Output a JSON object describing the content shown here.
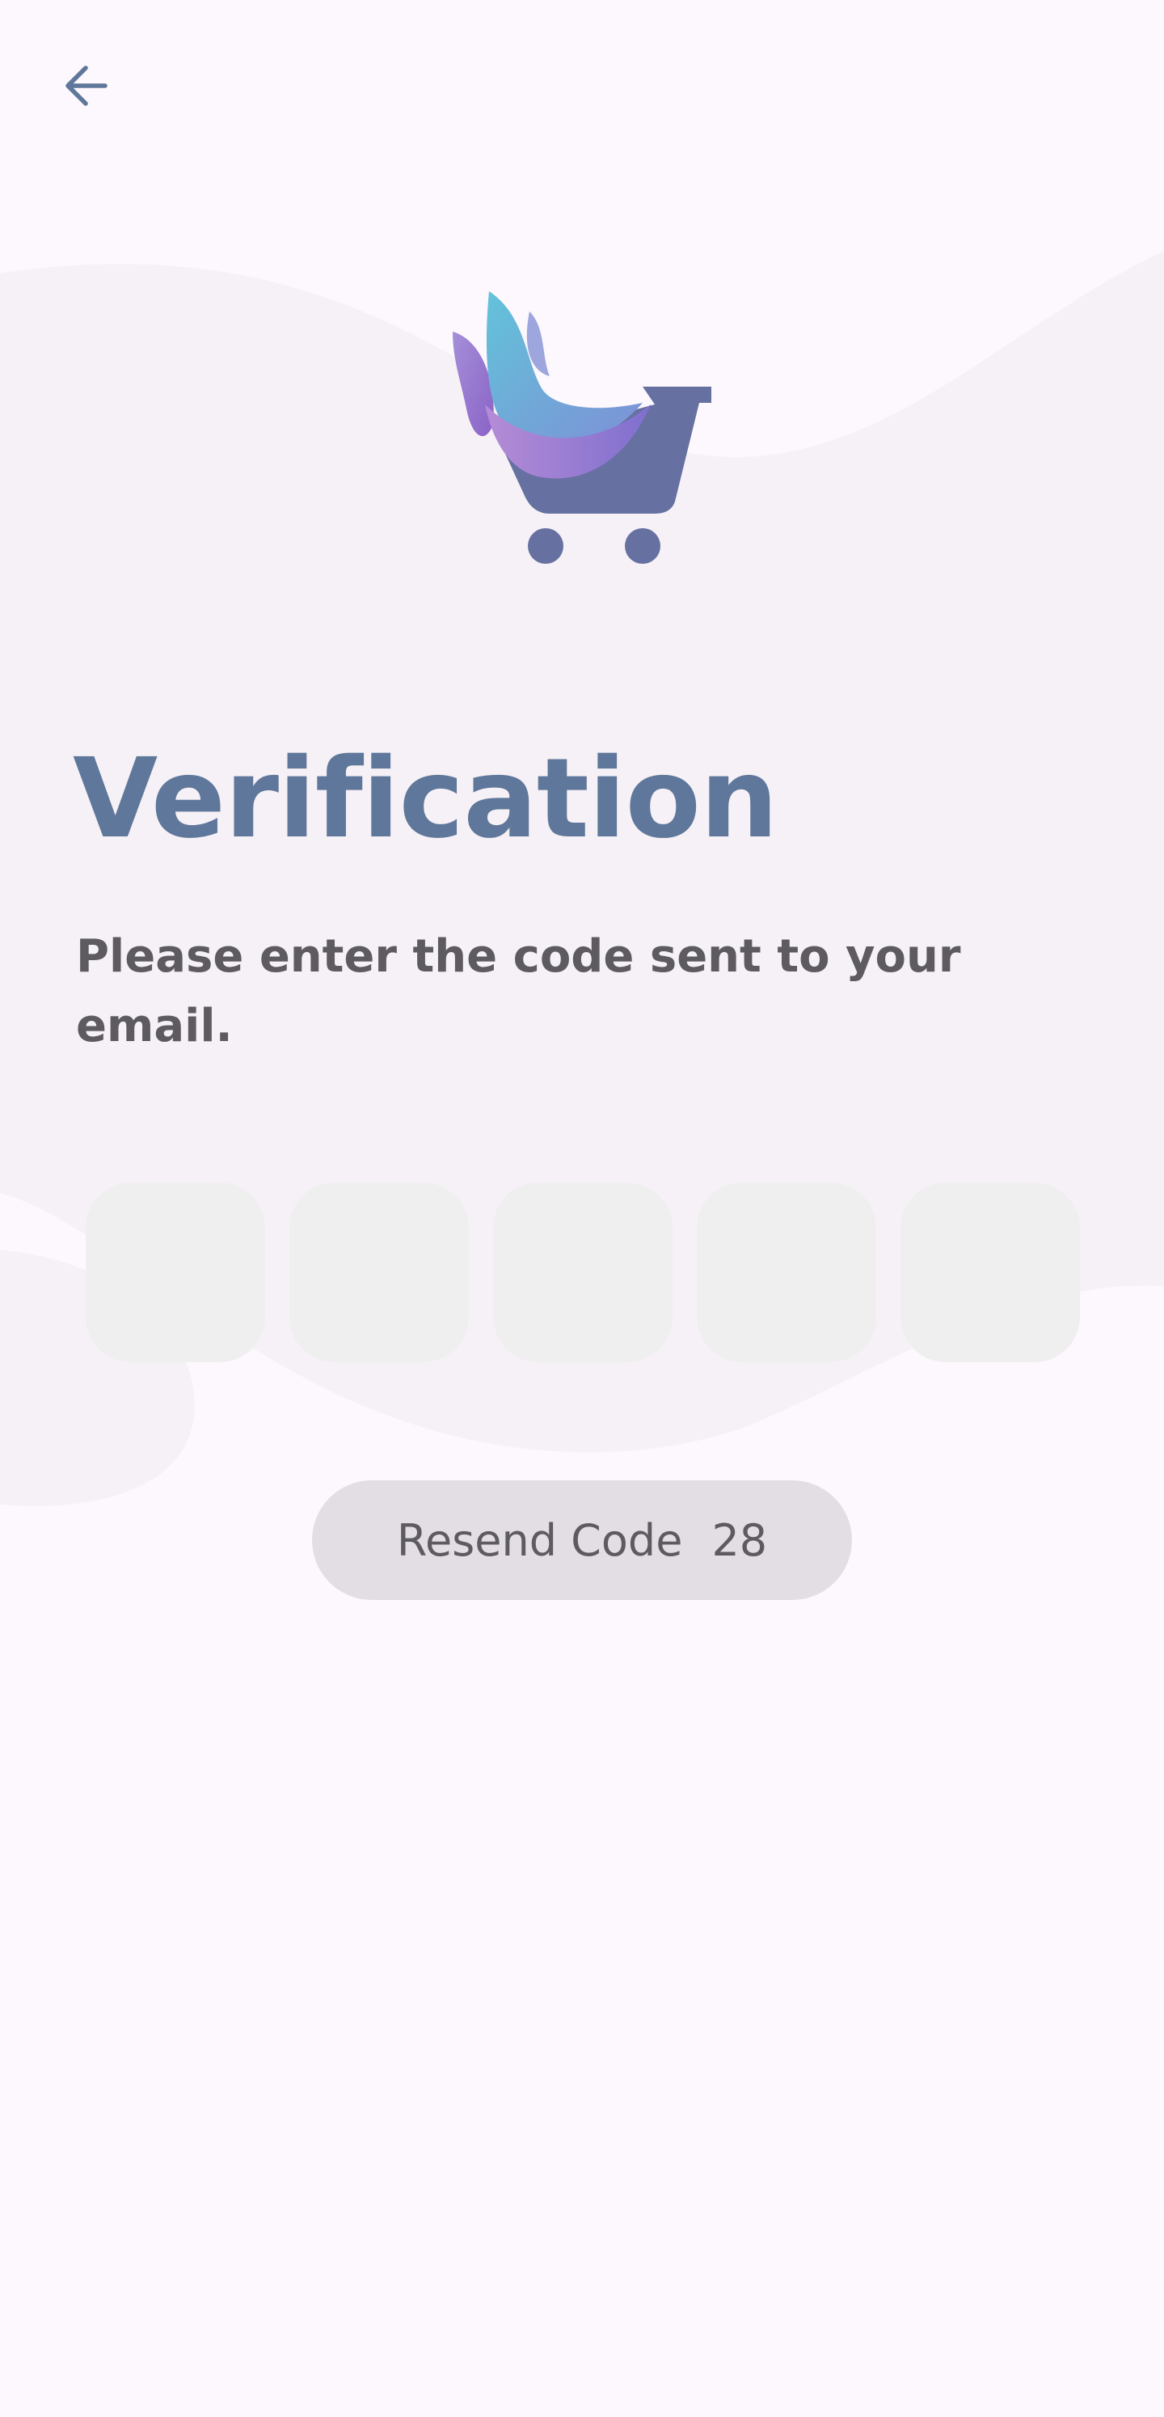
{
  "header": {
    "back_icon": "arrow-left-icon"
  },
  "logo": {
    "icon": "shopping-cart-flame-logo"
  },
  "title": "Verification",
  "subtitle": "Please enter the code sent to your email.",
  "otp": {
    "length": 5,
    "values": [
      "",
      "",
      "",
      "",
      ""
    ]
  },
  "resend": {
    "label": "Resend Code",
    "countdown": "28"
  },
  "colors": {
    "background": "#FDF8FD",
    "wave": "#F6F1F6",
    "title": "#5F779A",
    "text": "#5E5B60",
    "input_bg": "#EFEFEF",
    "button_bg": "#E2DEE3",
    "cart": "#6670A1"
  }
}
